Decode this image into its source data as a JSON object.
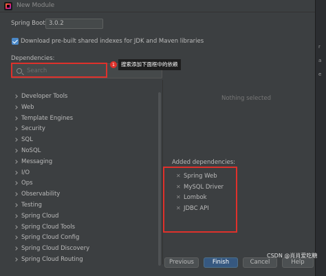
{
  "window": {
    "title": "New Module"
  },
  "spring_boot": {
    "label": "Spring Boot:",
    "value": "3.0.2"
  },
  "download_indexes": {
    "label": "Download pre-built shared indexes for JDK and Maven libraries",
    "checked": true
  },
  "dependencies": {
    "label": "Dependencies:",
    "search_placeholder": "Search",
    "categories": [
      "Developer Tools",
      "Web",
      "Template Engines",
      "Security",
      "SQL",
      "NoSQL",
      "Messaging",
      "I/O",
      "Ops",
      "Observability",
      "Testing",
      "Spring Cloud",
      "Spring Cloud Tools",
      "Spring Cloud Config",
      "Spring Cloud Discovery",
      "Spring Cloud Routing"
    ]
  },
  "annotation": {
    "badge": "1",
    "text": "搜索添加下面框中的依赖"
  },
  "details": {
    "empty_text": "Nothing selected"
  },
  "added": {
    "label": "Added dependencies:",
    "items": [
      "Spring Web",
      "MySQL Driver",
      "Lombok",
      "JDBC API"
    ]
  },
  "buttons": {
    "previous": "Previous",
    "finish": "Finish",
    "cancel": "Cancel",
    "help": "Help"
  },
  "watermark": "CSDN @肖肖爱吃糖",
  "colors": {
    "accent": "#365880",
    "annotation_red": "#e0312b",
    "checkbox": "#4a88c7"
  }
}
